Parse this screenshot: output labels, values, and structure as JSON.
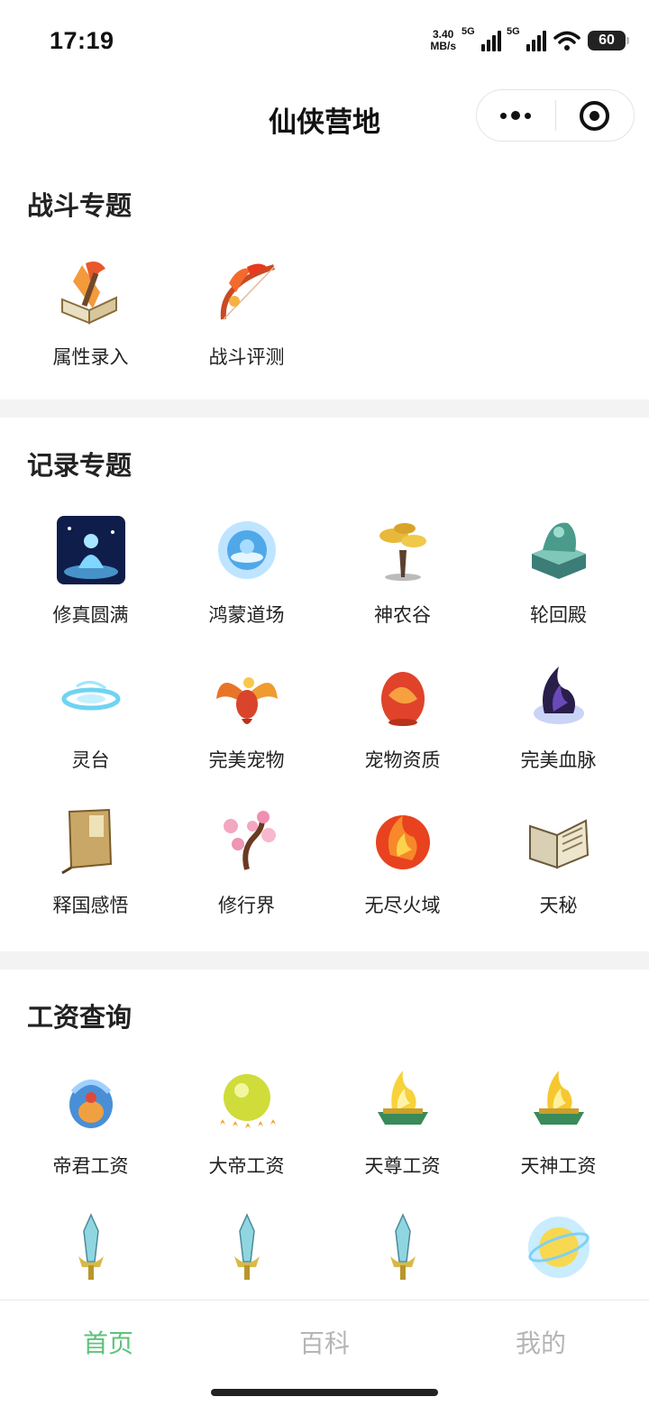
{
  "status": {
    "time": "17:19",
    "net_speed_value": "3.40",
    "net_speed_unit": "MB/s",
    "sim1": "5G",
    "sim2": "5G",
    "battery": "60"
  },
  "nav": {
    "title": "仙侠营地"
  },
  "sections": [
    {
      "title": "战斗专题",
      "items": [
        {
          "label": "属性录入",
          "icon": "attribute-book-icon"
        },
        {
          "label": "战斗评测",
          "icon": "flame-bow-icon"
        }
      ]
    },
    {
      "title": "记录专题",
      "items": [
        {
          "label": "修真圆满",
          "icon": "meditating-figure-icon"
        },
        {
          "label": "鸿蒙道场",
          "icon": "glowing-portal-icon"
        },
        {
          "label": "神农谷",
          "icon": "golden-tree-icon"
        },
        {
          "label": "轮回殿",
          "icon": "jade-seal-icon"
        },
        {
          "label": "灵台",
          "icon": "water-swirl-icon"
        },
        {
          "label": "完美宠物",
          "icon": "phoenix-icon"
        },
        {
          "label": "宠物资质",
          "icon": "dragon-egg-icon"
        },
        {
          "label": "完美血脉",
          "icon": "dark-flame-icon"
        },
        {
          "label": "释国感悟",
          "icon": "scroll-book-icon"
        },
        {
          "label": "修行界",
          "icon": "plum-blossom-icon"
        },
        {
          "label": "无尽火域",
          "icon": "fireball-icon"
        },
        {
          "label": "天秘",
          "icon": "open-book-icon"
        }
      ]
    },
    {
      "title": "工资查询",
      "items": [
        {
          "label": "帝君工资",
          "icon": "blue-treasure-icon"
        },
        {
          "label": "大帝工资",
          "icon": "golden-orb-stars-icon"
        },
        {
          "label": "天尊工资",
          "icon": "golden-flame-altar-icon"
        },
        {
          "label": "天神工资",
          "icon": "golden-flame-altar-icon"
        },
        {
          "label": "",
          "icon": "crystal-sword-icon"
        },
        {
          "label": "",
          "icon": "crystal-sword-icon"
        },
        {
          "label": "",
          "icon": "crystal-sword-icon"
        },
        {
          "label": "",
          "icon": "glowing-sun-orb-icon"
        }
      ]
    }
  ],
  "tabs": [
    {
      "label": "首页",
      "active": true
    },
    {
      "label": "百科",
      "active": false
    },
    {
      "label": "我的",
      "active": false
    }
  ],
  "colors": {
    "accent": "#5fc27c",
    "inactive_tab": "#b5b5b5",
    "section_gap": "#f3f3f3"
  }
}
